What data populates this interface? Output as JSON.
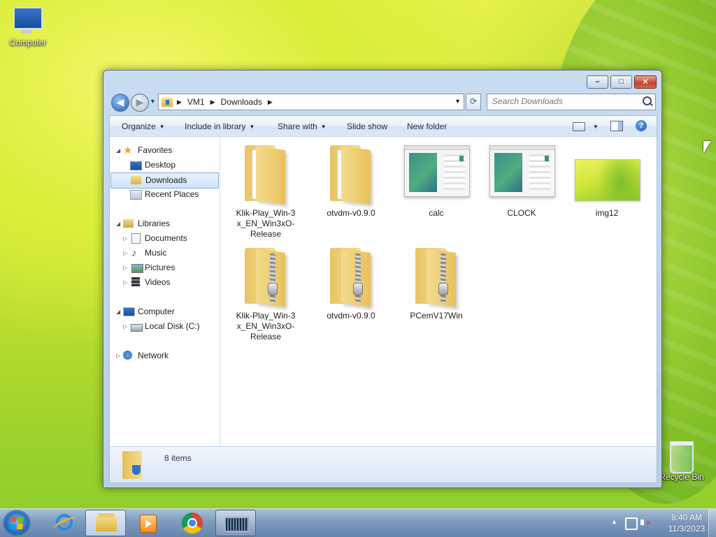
{
  "desktop": {
    "icons": [
      {
        "label": "Computer",
        "icon": "computer-icon"
      },
      {
        "label": "Recycle Bin",
        "icon": "recycle-bin-icon"
      }
    ]
  },
  "window": {
    "caption_buttons": {
      "minimize": "–",
      "maximize": "□",
      "close": "✕"
    },
    "nav": {
      "back": "◀",
      "forward": "▶",
      "history": "▼"
    },
    "address": {
      "crumbs": [
        "VM1",
        "Downloads"
      ],
      "separator": "▶",
      "dropdown": "▼",
      "refresh": "⟳"
    },
    "search": {
      "placeholder": "Search Downloads"
    },
    "toolbar": {
      "organize": "Organize",
      "include_in_library": "Include in library",
      "share_with": "Share with",
      "slide_show": "Slide show",
      "new_folder": "New folder",
      "dropdown_arrow": "▼",
      "help": "?"
    },
    "nav_pane": {
      "favorites": {
        "label": "Favorites",
        "items": [
          "Desktop",
          "Downloads",
          "Recent Places"
        ]
      },
      "libraries": {
        "label": "Libraries",
        "items": [
          "Documents",
          "Music",
          "Pictures",
          "Videos"
        ]
      },
      "computer": {
        "label": "Computer",
        "items": [
          "Local Disk (C:)"
        ]
      },
      "network": {
        "label": "Network"
      },
      "expanded_arrow": "◢",
      "collapsed_arrow": "▷",
      "selected": "Downloads"
    },
    "files": [
      {
        "name": "Klik-Play_Win-3x_EN_Win3xO-Release",
        "type": "folder"
      },
      {
        "name": "otvdm-v0.9.0",
        "type": "folder"
      },
      {
        "name": "calc",
        "type": "application"
      },
      {
        "name": "CLOCK",
        "type": "application"
      },
      {
        "name": "img12",
        "type": "image"
      },
      {
        "name": "Klik-Play_Win-3x_EN_Win3xO-Release",
        "type": "zip"
      },
      {
        "name": "otvdm-v0.9.0",
        "type": "zip"
      },
      {
        "name": "PCemV17Win",
        "type": "zip"
      }
    ],
    "details": {
      "count": "8 items"
    }
  },
  "taskbar": {
    "pinned": [
      "internet-explorer-icon",
      "windows-explorer-icon",
      "media-player-icon",
      "chrome-icon",
      "keyboard-app-icon"
    ],
    "tray": {
      "show_hidden": "▲",
      "time": "8:40 AM",
      "date": "11/3/2023"
    }
  },
  "colors": {
    "accent": "#2f6fd0",
    "selection": "#cfe4fa",
    "taskbar": "#7e9bbd"
  }
}
